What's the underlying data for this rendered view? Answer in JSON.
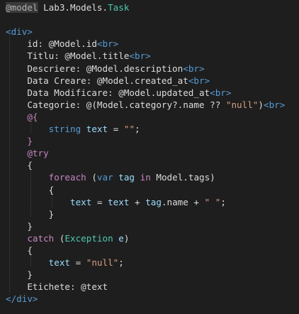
{
  "colors": {
    "background": "#1e1e1e",
    "razor": "#b0b0b0",
    "text": "#dcdcdc",
    "identifier": "#9cdcfe",
    "type": "#4ec9b0",
    "keyword": "#569cd6",
    "control": "#c586c0",
    "string": "#d69d85",
    "tag": "#569cd6",
    "delim_open": "#c586c0",
    "method_brace": "#ffd700"
  },
  "lines": [
    {
      "tokens": [
        {
          "t": "@model",
          "c": "razor",
          "hl": true
        },
        {
          "t": " Lab3.Models.",
          "c": "text"
        },
        {
          "t": "Task",
          "c": "type"
        }
      ]
    },
    {
      "tokens": []
    },
    {
      "tokens": [
        {
          "t": "<div>",
          "c": "tag"
        }
      ]
    },
    {
      "tokens": [
        {
          "t": "    id: ",
          "c": "text"
        },
        {
          "t": "@Model",
          "c": "text"
        },
        {
          "t": ".id",
          "c": "text"
        },
        {
          "t": "<br>",
          "c": "tag"
        }
      ]
    },
    {
      "tokens": [
        {
          "t": "    Titlu: ",
          "c": "text"
        },
        {
          "t": "@Model",
          "c": "text"
        },
        {
          "t": ".title",
          "c": "text"
        },
        {
          "t": "<br>",
          "c": "tag"
        }
      ]
    },
    {
      "tokens": [
        {
          "t": "    Descriere: ",
          "c": "text"
        },
        {
          "t": "@Model",
          "c": "text"
        },
        {
          "t": ".description",
          "c": "text"
        },
        {
          "t": "<br>",
          "c": "tag"
        }
      ]
    },
    {
      "tokens": [
        {
          "t": "    Data Creare: ",
          "c": "text"
        },
        {
          "t": "@Model",
          "c": "text"
        },
        {
          "t": ".created_at",
          "c": "text"
        },
        {
          "t": "<br>",
          "c": "tag"
        }
      ]
    },
    {
      "tokens": [
        {
          "t": "    Data Modificare: ",
          "c": "text"
        },
        {
          "t": "@Model",
          "c": "text"
        },
        {
          "t": ".updated_at",
          "c": "text"
        },
        {
          "t": "<br>",
          "c": "tag"
        }
      ]
    },
    {
      "tokens": [
        {
          "t": "    Categorie: ",
          "c": "text"
        },
        {
          "t": "@(",
          "c": "text"
        },
        {
          "t": "Model",
          "c": "text"
        },
        {
          "t": ".category?.name ?? ",
          "c": "text"
        },
        {
          "t": "\"null\"",
          "c": "string"
        },
        {
          "t": ")",
          "c": "text"
        },
        {
          "t": "<br>",
          "c": "tag"
        }
      ]
    },
    {
      "tokens": [
        {
          "t": "    ",
          "c": "text"
        },
        {
          "t": "@{",
          "c": "delim_open"
        }
      ]
    },
    {
      "tokens": [
        {
          "t": "        ",
          "c": "text"
        },
        {
          "t": "string",
          "c": "keyword"
        },
        {
          "t": " ",
          "c": "text"
        },
        {
          "t": "text",
          "c": "identifier"
        },
        {
          "t": " = ",
          "c": "text"
        },
        {
          "t": "\"\"",
          "c": "string"
        },
        {
          "t": ";",
          "c": "text"
        }
      ]
    },
    {
      "tokens": [
        {
          "t": "    ",
          "c": "text"
        },
        {
          "t": "}",
          "c": "delim_open"
        }
      ]
    },
    {
      "tokens": [
        {
          "t": "    ",
          "c": "text"
        },
        {
          "t": "@try",
          "c": "control"
        }
      ]
    },
    {
      "tokens": [
        {
          "t": "    {",
          "c": "text"
        }
      ]
    },
    {
      "tokens": [
        {
          "t": "        ",
          "c": "text"
        },
        {
          "t": "foreach",
          "c": "control"
        },
        {
          "t": " (",
          "c": "text"
        },
        {
          "t": "var",
          "c": "keyword"
        },
        {
          "t": " ",
          "c": "text"
        },
        {
          "t": "tag",
          "c": "identifier"
        },
        {
          "t": " ",
          "c": "text"
        },
        {
          "t": "in",
          "c": "control"
        },
        {
          "t": " Model.tags)",
          "c": "text"
        }
      ]
    },
    {
      "tokens": [
        {
          "t": "        {",
          "c": "text"
        }
      ]
    },
    {
      "tokens": [
        {
          "t": "            ",
          "c": "text"
        },
        {
          "t": "text",
          "c": "identifier"
        },
        {
          "t": " = ",
          "c": "text"
        },
        {
          "t": "text",
          "c": "identifier"
        },
        {
          "t": " + ",
          "c": "text"
        },
        {
          "t": "tag",
          "c": "identifier"
        },
        {
          "t": ".name + ",
          "c": "text"
        },
        {
          "t": "\" \"",
          "c": "string"
        },
        {
          "t": ";",
          "c": "text"
        }
      ]
    },
    {
      "tokens": [
        {
          "t": "        }",
          "c": "text"
        }
      ]
    },
    {
      "tokens": [
        {
          "t": "    }",
          "c": "text"
        }
      ]
    },
    {
      "tokens": [
        {
          "t": "    ",
          "c": "text"
        },
        {
          "t": "catch",
          "c": "control"
        },
        {
          "t": " (",
          "c": "text"
        },
        {
          "t": "Exception",
          "c": "type"
        },
        {
          "t": " ",
          "c": "text"
        },
        {
          "t": "e",
          "c": "identifier"
        },
        {
          "t": ")",
          "c": "text"
        }
      ]
    },
    {
      "tokens": [
        {
          "t": "    {",
          "c": "text"
        }
      ]
    },
    {
      "tokens": [
        {
          "t": "        ",
          "c": "text"
        },
        {
          "t": "text",
          "c": "identifier"
        },
        {
          "t": " = ",
          "c": "text"
        },
        {
          "t": "\"null\"",
          "c": "string"
        },
        {
          "t": ";",
          "c": "text"
        }
      ]
    },
    {
      "tokens": [
        {
          "t": "    }",
          "c": "text"
        }
      ]
    },
    {
      "tokens": [
        {
          "t": "    Etichete: ",
          "c": "text"
        },
        {
          "t": "@text",
          "c": "text"
        }
      ]
    },
    {
      "tokens": [
        {
          "t": "</div>",
          "c": "tag"
        }
      ]
    }
  ]
}
